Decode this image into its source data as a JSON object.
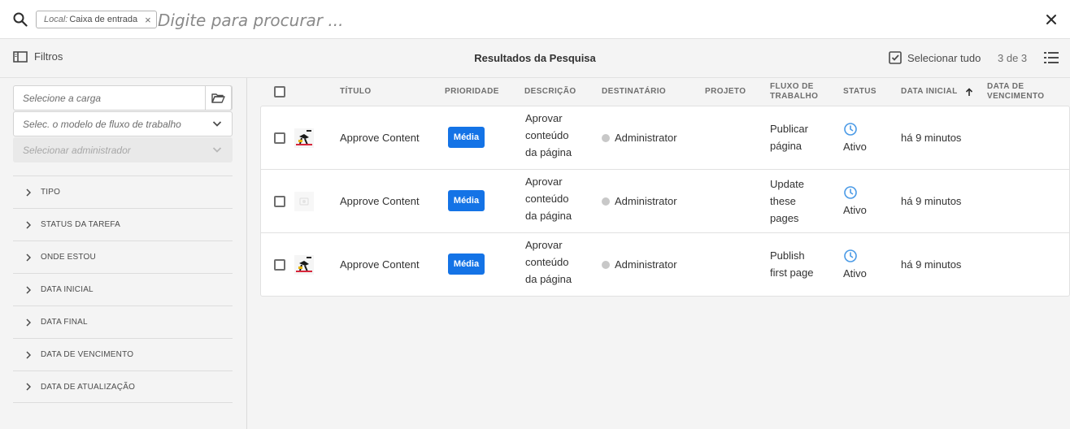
{
  "search": {
    "tag_key": "Local:",
    "tag_value": "Caixa de entrada",
    "tag_close": "×",
    "placeholder": "Digite para procurar ..."
  },
  "toolbar": {
    "filters_label": "Filtros",
    "results_title": "Resultados da Pesquisa",
    "select_all_label": "Selecionar tudo",
    "count": "3 de 3"
  },
  "sidebar": {
    "path_placeholder": "Selecione a carga",
    "model_placeholder": "Selec. o modelo de fluxo de trabalho",
    "admin_placeholder": "Selecionar administrador",
    "facets": [
      "TIPO",
      "STATUS DA TAREFA",
      "ONDE ESTOU",
      "DATA INICIAL",
      "DATA FINAL",
      "DATA DE VENCIMENTO",
      "DATA DE ATUALIZAÇÃO"
    ]
  },
  "table": {
    "columns": {
      "title": "TÍTULO",
      "priority": "PRIORIDADE",
      "description": "DESCRIÇÃO",
      "assignee": "DESTINATÁRIO",
      "project": "PROJETO",
      "workflow_1": "FLUXO DE",
      "workflow_2": "TRABALHO",
      "status": "STATUS",
      "start_date": "DATA INICIAL",
      "due_1": "DATA DE",
      "due_2": "VENCIMENTO"
    },
    "rows": [
      {
        "title": "Approve Content",
        "priority": "Média",
        "desc_1": "Aprovar",
        "desc_2": "conteúdo",
        "desc_3": "da página",
        "assignee": "Administrator",
        "project": "",
        "workflow_1": "Publicar",
        "workflow_2": "página",
        "workflow_3": "",
        "status": "Ativo",
        "start": "há 9 minutos",
        "due": "",
        "thumb_icon": "page-thumbnail-icon"
      },
      {
        "title": "Approve Content",
        "priority": "Média",
        "desc_1": "Aprovar",
        "desc_2": "conteúdo",
        "desc_3": "da página",
        "assignee": "Administrator",
        "project": "",
        "workflow_1": "Update",
        "workflow_2": "these",
        "workflow_3": "pages",
        "status": "Ativo",
        "start": "há 9 minutos",
        "due": "",
        "thumb_icon": "placeholder-thumbnail-icon"
      },
      {
        "title": "Approve Content",
        "priority": "Média",
        "desc_1": "Aprovar",
        "desc_2": "conteúdo",
        "desc_3": "da página",
        "assignee": "Administrator",
        "project": "",
        "workflow_1": "Publish",
        "workflow_2": "first page",
        "workflow_3": "",
        "status": "Ativo",
        "start": "há 9 minutos",
        "due": "",
        "thumb_icon": "page-thumbnail-icon"
      }
    ]
  },
  "colors": {
    "accent": "#1473e6",
    "status_icon": "#4a9ae6"
  }
}
